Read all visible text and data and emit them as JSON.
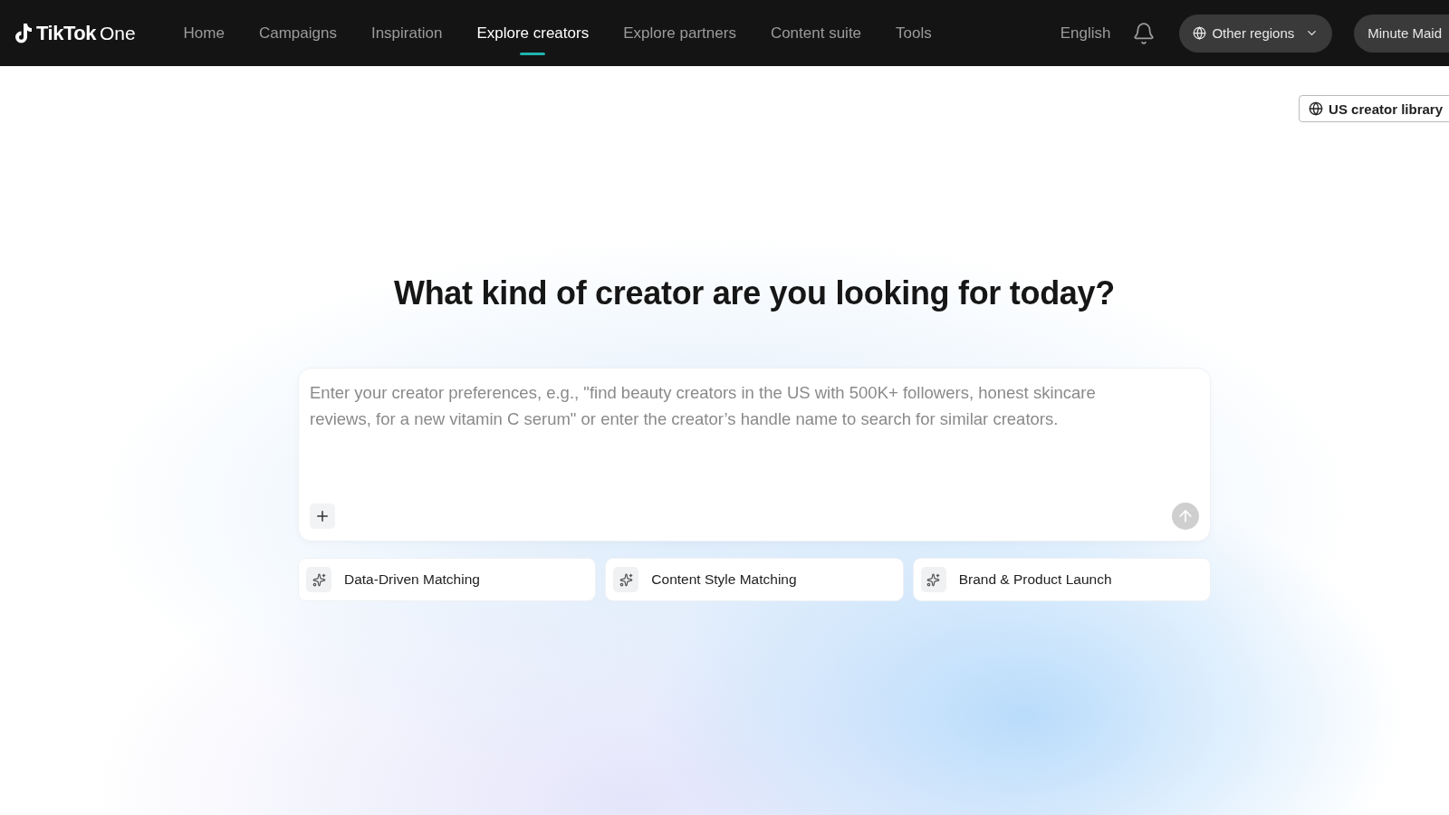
{
  "logo": {
    "brand": "TikTok",
    "product": "One"
  },
  "nav": [
    {
      "label": "Home",
      "selected": false
    },
    {
      "label": "Campaigns",
      "selected": false
    },
    {
      "label": "Inspiration",
      "selected": false
    },
    {
      "label": "Explore creators",
      "selected": true
    },
    {
      "label": "Explore partners",
      "selected": false
    },
    {
      "label": "Content suite",
      "selected": false
    },
    {
      "label": "Tools",
      "selected": false
    }
  ],
  "language": "English",
  "region": "Other regions",
  "account": "Minute Maid",
  "library": "US creator library",
  "heading": "What kind of creator are you looking for today?",
  "prompt": {
    "placeholder": "Enter your creator preferences, e.g., \"find beauty creators in the US with 500K+ followers, honest skincare reviews, for a new vitamin C serum\" or enter the creator’s handle name to search for similar creators."
  },
  "suggestions": [
    "Data-Driven Matching",
    "Content Style Matching",
    "Brand & Product Launch"
  ]
}
